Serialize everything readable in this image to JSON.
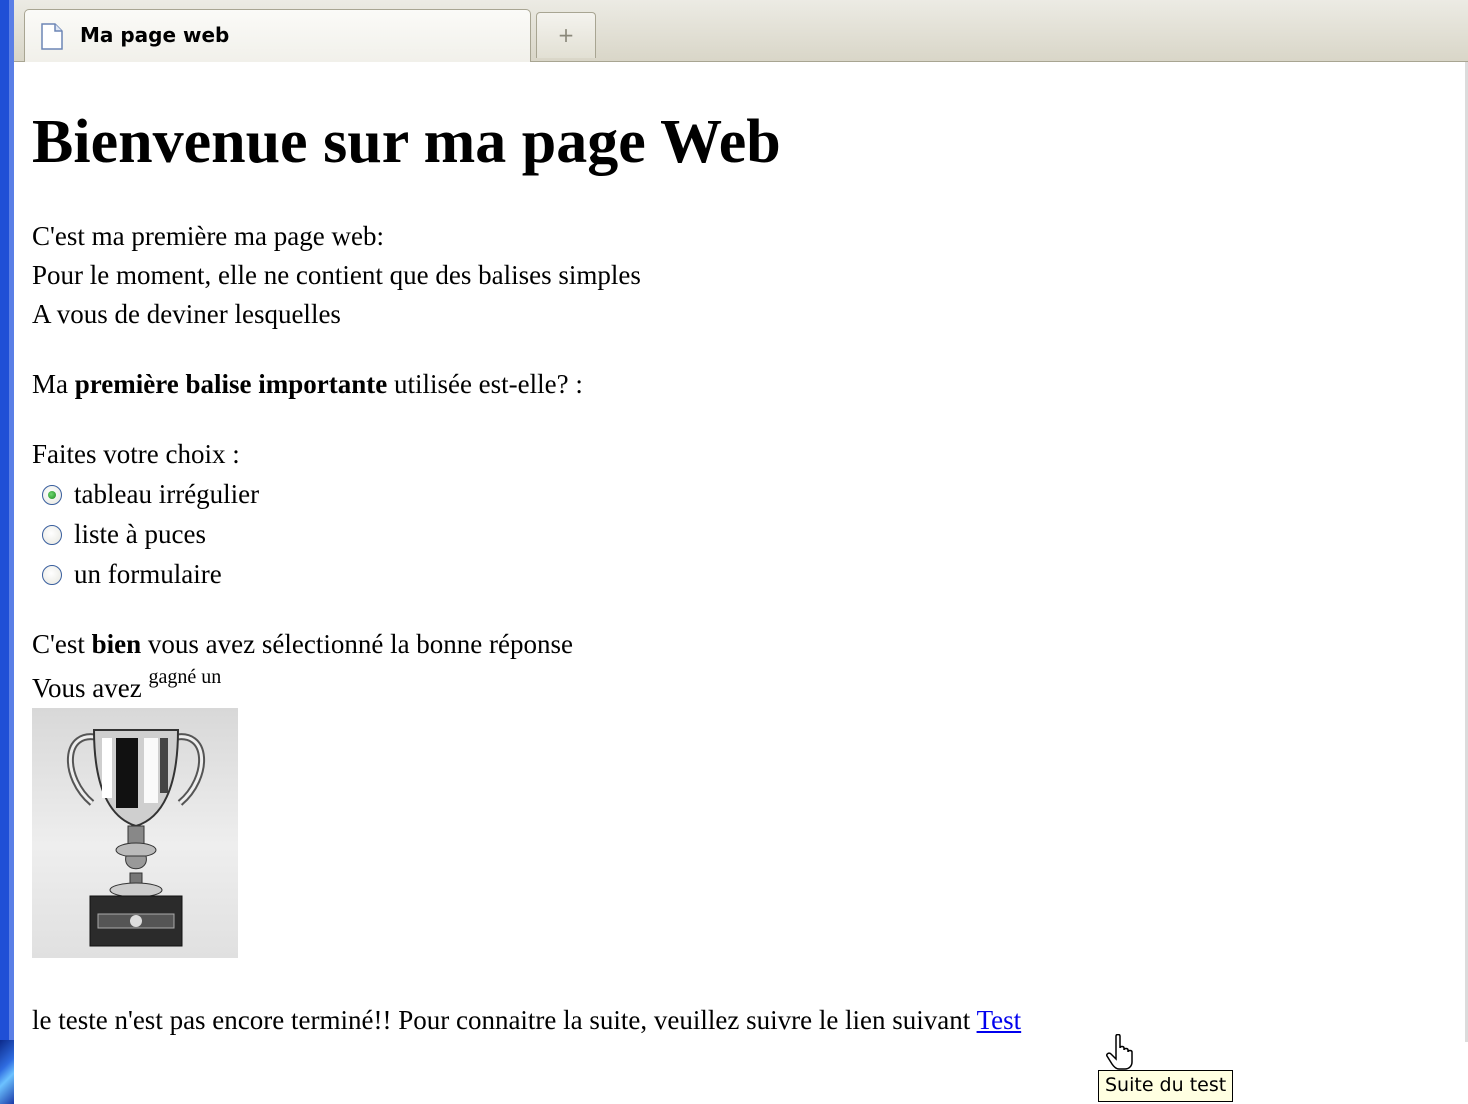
{
  "browser": {
    "tab_title": "Ma page web",
    "new_tab_symbol": "+"
  },
  "page": {
    "heading": "Bienvenue sur ma page Web",
    "intro_lines": [
      "C'est ma première ma page web:",
      "Pour le moment, elle ne contient que des balises simples",
      "A vous de deviner lesquelles"
    ],
    "question": {
      "prefix": "Ma ",
      "bold": "première balise importante",
      "suffix": " utilisée est-elle? :"
    },
    "choice_prompt": "Faites votre choix :",
    "choices": [
      {
        "label": "tableau irrégulier",
        "checked": true
      },
      {
        "label": "liste à puces",
        "checked": false
      },
      {
        "label": "un formulaire",
        "checked": false
      }
    ],
    "result": {
      "prefix": "C'est ",
      "bold": "bien",
      "suffix": " vous avez sélectionné la bonne réponse"
    },
    "won_line": {
      "text": "Vous avez ",
      "superscript": "gagné un"
    },
    "trophy_icon": "trophy-image",
    "footer": {
      "text": "le teste n'est pas encore terminé!! Pour connaitre la suite, veuillez suivre le lien suivant ",
      "link_text": "Test"
    },
    "tooltip": "Suite du test"
  }
}
